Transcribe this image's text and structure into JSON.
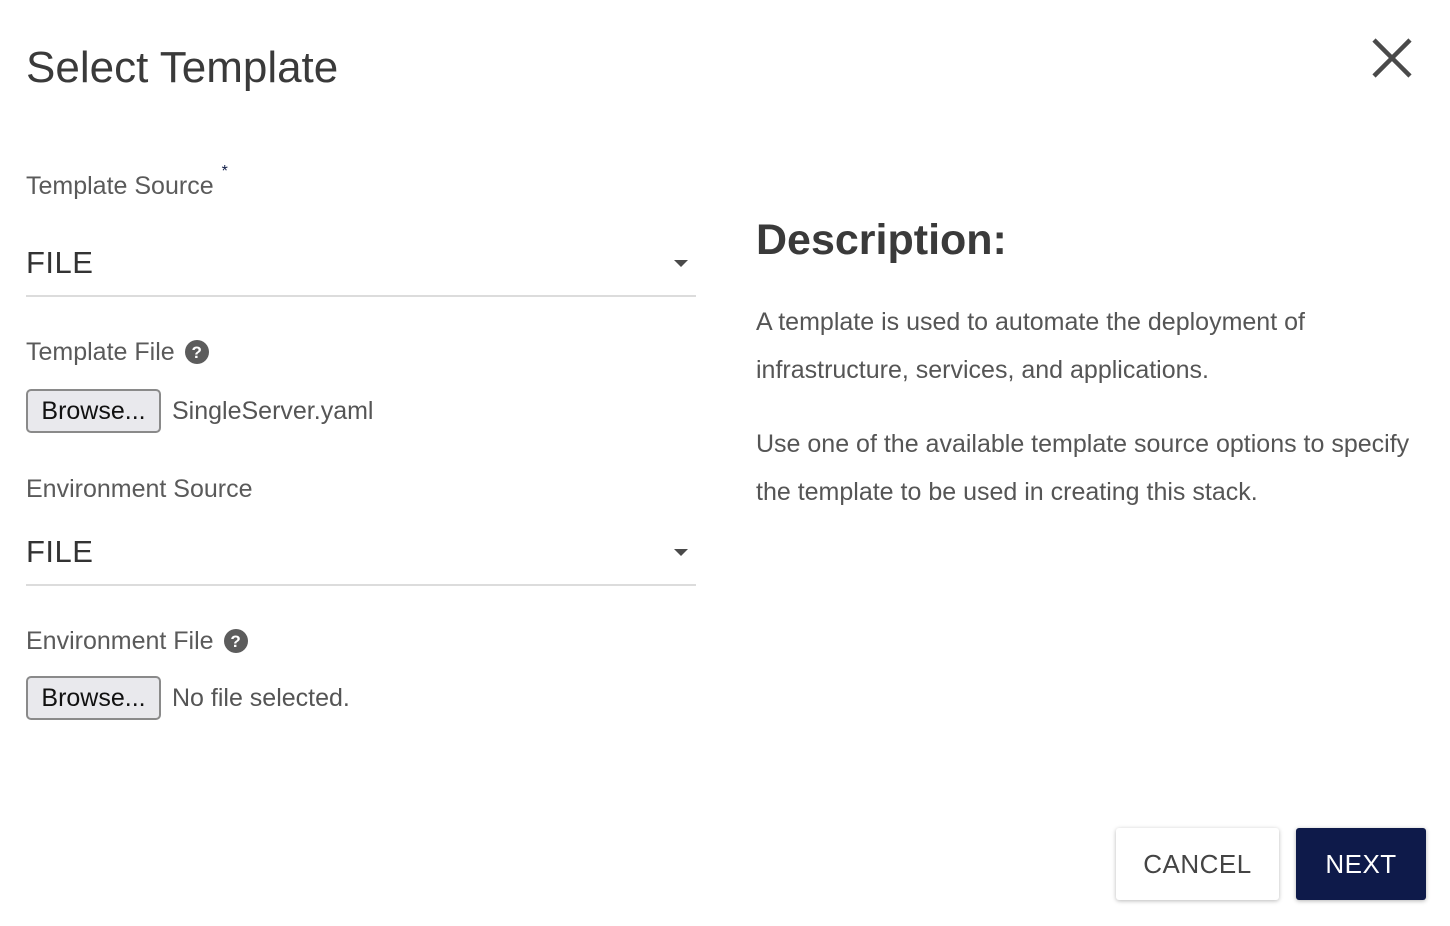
{
  "dialog": {
    "title": "Select Template"
  },
  "form": {
    "template_source": {
      "label": "Template Source",
      "required_marker": "*",
      "value": "FILE"
    },
    "template_file": {
      "label": "Template File",
      "help_glyph": "?",
      "browse_label": "Browse...",
      "file_name": "SingleServer.yaml"
    },
    "environment_source": {
      "label": "Environment Source",
      "value": "FILE"
    },
    "environment_file": {
      "label": "Environment File",
      "help_glyph": "?",
      "browse_label": "Browse...",
      "file_name": "No file selected."
    }
  },
  "description": {
    "heading": "Description:",
    "paragraphs": [
      "A template is used to automate the deployment of infrastructure, services, and applications.",
      "Use one of the available template source options to specify the template to be used in creating this stack."
    ]
  },
  "footer": {
    "cancel_label": "CANCEL",
    "next_label": "NEXT"
  },
  "colors": {
    "primary": "#0e1a4a",
    "text": "#444444",
    "divider": "#dcdcdc"
  },
  "icons": {
    "close": "close-icon",
    "help": "help-circle-icon",
    "dropdown": "caret-down-icon"
  }
}
